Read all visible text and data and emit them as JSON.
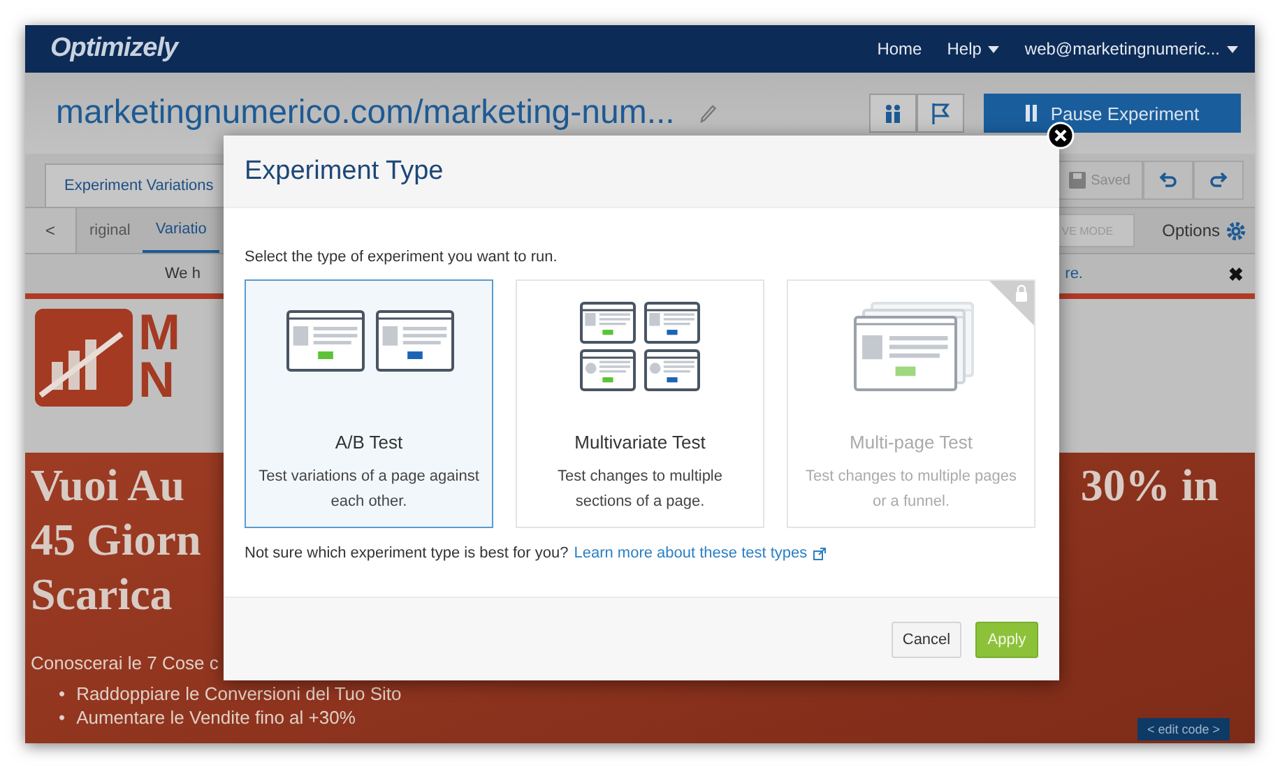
{
  "top_nav": {
    "logo": "Optimizely",
    "links": [
      {
        "label": "Home",
        "dropdown": false
      },
      {
        "label": "Help",
        "dropdown": true
      },
      {
        "label": "web@marketingnumeric...",
        "dropdown": true
      }
    ]
  },
  "header": {
    "title": "marketingnumerico.com/marketing-num...",
    "pause_button": "Pause Experiment"
  },
  "tabs": [
    {
      "label": "Experiment Variations",
      "selected": true
    }
  ],
  "toolbar": {
    "saved_label": "Saved"
  },
  "variation_tabs": {
    "prev": "<",
    "items": [
      {
        "label": "riginal",
        "selected": false
      },
      {
        "label": "Variatio",
        "selected": true
      }
    ]
  },
  "mode_button": "VE MODE",
  "options_label": "Options",
  "notice": {
    "left": "We h",
    "right": "re.",
    "close": "✖"
  },
  "site": {
    "logo_lines": [
      "M",
      "N"
    ],
    "headline": [
      {
        "left": "Vuoi Au",
        "right": "30% in"
      },
      {
        "left": "45 Giorn"
      },
      {
        "left": "Scarica"
      }
    ],
    "intro": "Conoscerai le 7 Cose c",
    "bullets": [
      {
        "marker": "•",
        "text": "Raddoppiare le Conversioni del Tuo Sito"
      },
      {
        "marker": "•",
        "text": "Aumentare le Vendite fino al +30%"
      }
    ],
    "edit_code": "< edit code >"
  },
  "modal": {
    "title": "Experiment Type",
    "instruction": "Select the type of experiment you want to run.",
    "options": [
      {
        "kind": "ab",
        "title": "A/B Test",
        "description": "Test variations of a page against each other.",
        "selected": true,
        "disabled": false
      },
      {
        "kind": "multivariate",
        "title": "Multivariate Test",
        "description": "Test changes to multiple sections of a page.",
        "selected": false,
        "disabled": false
      },
      {
        "kind": "multipage",
        "title": "Multi-page Test",
        "description": "Test changes to multiple pages or a funnel.",
        "selected": false,
        "disabled": true
      }
    ],
    "help_text": "Not sure which experiment type is best for you?",
    "help_link": "Learn more about these test types",
    "buttons": [
      {
        "label": "Cancel",
        "kind": "secondary"
      },
      {
        "label": "Apply",
        "kind": "primary"
      }
    ]
  }
}
